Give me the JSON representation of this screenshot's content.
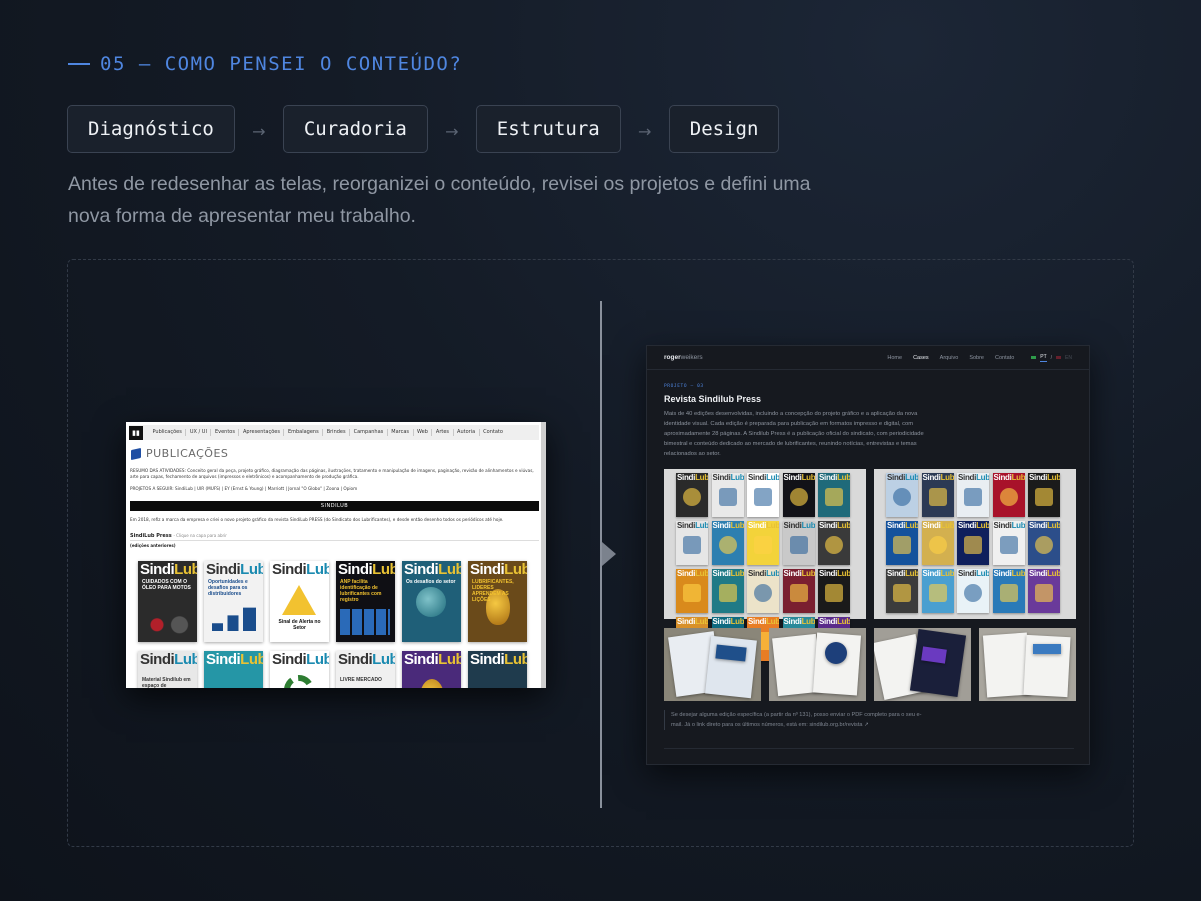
{
  "section": {
    "label": "05 — COMO PENSEI O CONTEÚDO?"
  },
  "steps": [
    "Diagnóstico",
    "Curadoria",
    "Estrutura",
    "Design"
  ],
  "step_arrow": "→",
  "intro": "Antes de redesenhar as telas, reorganizei o conteúdo, revisei os projetos e defini uma nova forma de apresentar meu trabalho.",
  "colors": {
    "accent": "#4f86e0",
    "background": "#141b26",
    "step_border": "#3a4352",
    "muted_text": "#8f97a3"
  },
  "old_site": {
    "nav": [
      "Publicações",
      "UX / UI",
      "Eventos",
      "Apresentações",
      "Embalagens",
      "Brindes",
      "Campanhas",
      "Marcas",
      "Web",
      "Artes",
      "Autoria",
      "Contato"
    ],
    "title": "PUBLICAÇÕES",
    "summary": "RESUMO DAS ATIVIDADES: Conceito geral da peça, projeto gráfico, diagramação das páginas, ilustrações, tratamento e manipulação de imagens, paginação, revisão de alinhamentos e viúvas, arte para capas, fechamento de arquivos (impressos e eletrônicos) e acompanhamento de produção gráfica.",
    "projects": "PROJETOS A SEGUIR: SindiLub | UIR (MUFS) | EY (Ernst & Young) | Marriott | Jornal \"O Globo\" | Zoona | Opiom",
    "bar": "SINDILUB",
    "paragraph": "Em 2018, refiz a marca da empresa e criei o novo projeto gráfico da revista SindiLub PRESS (do Sindicato dos Lubrificantes), e desde então desenho todos os periódicos até hoje.",
    "subhead": "SindiLub Press",
    "subhead_hint": "- Clique na capa para abrir",
    "subhead2": "(edições anteriores)",
    "covers": [
      {
        "mast_a": "Sindi",
        "mast_b": "Lub",
        "line": "CUIDADOS COM O ÓLEO PARA MOTOS",
        "bg": "#2b2b2b",
        "fg": "#ffffff",
        "shape": "moto"
      },
      {
        "mast_a": "Sindi",
        "mast_b": "Lub",
        "line": "Oportunidades e desafios para os distribuidores",
        "bg": "#f2f2f2",
        "fg": "#1a4d8c",
        "shape": "stairs"
      },
      {
        "mast_a": "Sindi",
        "mast_b": "Lub",
        "line": "Sinal de Alerta no Setor",
        "bg": "#ffffff",
        "fg": "#111111",
        "shape": "alert"
      },
      {
        "mast_a": "Sindi",
        "mast_b": "Lub",
        "line": "ANP facilita identificação de lubrificantes com registro",
        "bg": "#0f0f14",
        "fg": "#f2c230",
        "shape": "grid"
      },
      {
        "mast_a": "Sindi",
        "mast_b": "Lub",
        "line": "Os desafios do setor",
        "bg": "#1f5f78",
        "fg": "#ffffff",
        "shape": "globe"
      },
      {
        "mast_a": "Sindi",
        "mast_b": "Lub",
        "line": "LUBRIFICANTES, LIDERES APRENDEM AS LIÇÕES",
        "bg": "#6a4a1a",
        "fg": "#f2c230",
        "shape": "oil"
      },
      {
        "mast_a": "Sindi",
        "mast_b": "Lub",
        "line": "Material Sindilub em espaço de",
        "bg": "#e8e8e8",
        "fg": "#333333",
        "shape": "plain"
      },
      {
        "mast_a": "Sindi",
        "mast_b": "Lub",
        "line": "",
        "bg": "#2596a6",
        "fg": "#ffffff",
        "shape": "plain"
      },
      {
        "mast_a": "Sindi",
        "mast_b": "Lub",
        "line": "",
        "bg": "#ffffff",
        "fg": "#2e7d32",
        "shape": "gear"
      },
      {
        "mast_a": "Sindi",
        "mast_b": "Lub",
        "line": "LIVRE MERCADO",
        "bg": "#f0f0f0",
        "fg": "#333333",
        "shape": "plain"
      },
      {
        "mast_a": "Sindi",
        "mast_b": "Lub",
        "line": "",
        "bg": "#4a2a7a",
        "fg": "#ffffff",
        "shape": "oil"
      },
      {
        "mast_a": "Sindi",
        "mast_b": "Lub",
        "line": "",
        "bg": "#1f3b4d",
        "fg": "#ffffff",
        "shape": "plain"
      }
    ]
  },
  "new_site": {
    "brand": "roger",
    "brand_suffix": "weikers",
    "nav": [
      "Home",
      "Cases",
      "Arquivo",
      "Sobre",
      "Contato"
    ],
    "active": "Cases",
    "lang_active": "PT",
    "lang_sep": "/",
    "lang_other": "EN",
    "eyebrow": "PROJETO — 03",
    "title": "Revista Sindilub Press",
    "description": "Mais de 40 edições desenvolvidas, incluindo a concepção do projeto gráfico e a aplicação da nova identidade visual. Cada edição é preparada para publicação em formatos impresso e digital, com aproximadamente 28 páginas. A Sindilub Press é a publicação oficial do sindicato, com periodicidade bimestral e conteúdo dedicado ao mercado de lubrificantes, reunindo notícias, entrevistas e temas relacionados ao setor.",
    "mast_a": "Sindi",
    "mast_b": "Lub",
    "left_panel_colors": [
      "#2a2a2a",
      "#e9e9e9",
      "#ffffff",
      "#121218",
      "#1f6a7a",
      "#e6e6e6",
      "#2d7fb0",
      "#f3d33a",
      "#c9c9c9",
      "#3a3a3a",
      "#d98a1c",
      "#207a86",
      "#ece3c9",
      "#7a1f30",
      "#1a1a1a",
      "#d8902a",
      "#0f6a80",
      "#e87d25",
      "#2a8a9a",
      "#5a2a8a"
    ],
    "right_panel_colors": [
      "#bcd0e4",
      "#2c3a54",
      "#e9eef2",
      "#a8122a",
      "#1b1b1b",
      "#14529c",
      "#d3b04f",
      "#0f1f5c",
      "#f0f0f0",
      "#2c4e8a",
      "#3c3c3c",
      "#4a9fd0",
      "#e9f2f7",
      "#2a7ab8",
      "#6a3a9a"
    ],
    "note": "Se desejar alguma edição específica (a partir da nº 131), posso enviar o PDF completo para o seu e-mail. Já o link direto para os últimos números, está em: sindilub.org.br/revista ↗"
  }
}
